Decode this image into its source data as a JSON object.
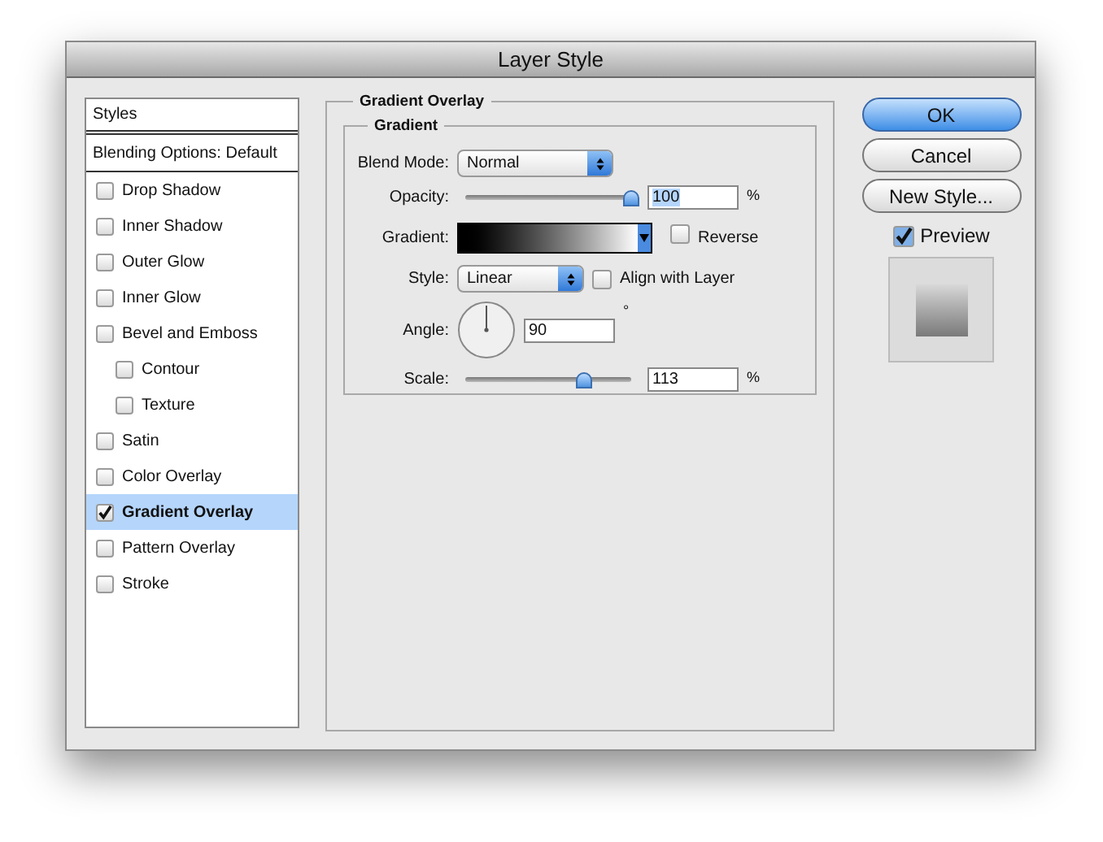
{
  "window": {
    "title": "Layer Style"
  },
  "sidebar": {
    "header": "Styles",
    "blending": "Blending Options: Default",
    "items": [
      {
        "label": "Drop Shadow",
        "checked": false,
        "selected": false
      },
      {
        "label": "Inner Shadow",
        "checked": false,
        "selected": false
      },
      {
        "label": "Outer Glow",
        "checked": false,
        "selected": false
      },
      {
        "label": "Inner Glow",
        "checked": false,
        "selected": false
      },
      {
        "label": "Bevel and Emboss",
        "checked": false,
        "selected": false,
        "children": [
          {
            "label": "Contour",
            "checked": false,
            "selected": false
          },
          {
            "label": "Texture",
            "checked": false,
            "selected": false
          }
        ]
      },
      {
        "label": "Satin",
        "checked": false,
        "selected": false
      },
      {
        "label": "Color Overlay",
        "checked": false,
        "selected": false
      },
      {
        "label": "Gradient Overlay",
        "checked": true,
        "selected": true
      },
      {
        "label": "Pattern Overlay",
        "checked": false,
        "selected": false
      },
      {
        "label": "Stroke",
        "checked": false,
        "selected": false
      }
    ]
  },
  "panel": {
    "title": "Gradient Overlay",
    "group": "Gradient",
    "blend_mode": {
      "label": "Blend Mode:",
      "value": "Normal"
    },
    "opacity": {
      "label": "Opacity:",
      "level": 1,
      "value": "100",
      "unit": "%"
    },
    "gradient": {
      "label": "Gradient:",
      "reverse": {
        "label": "Reverse",
        "checked": false
      }
    },
    "style": {
      "label": "Style:",
      "value": "Linear",
      "align": {
        "label": "Align with Layer",
        "checked": false
      }
    },
    "angle": {
      "label": "Angle:",
      "value": "90",
      "unit": "°"
    },
    "scale": {
      "label": "Scale:",
      "level": 0.72,
      "value": "113",
      "unit": "%"
    }
  },
  "buttons": [
    {
      "label": "OK",
      "default": true
    },
    {
      "label": "Cancel",
      "default": false
    },
    {
      "label": "New Style...",
      "default": false
    }
  ],
  "preview": {
    "label": "Preview",
    "checked": true
  }
}
